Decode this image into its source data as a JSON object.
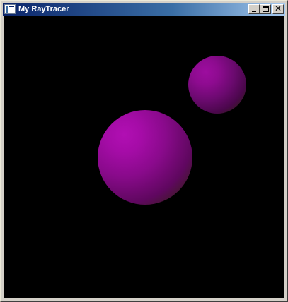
{
  "window": {
    "title": "My RayTracer"
  },
  "titlebar": {
    "buttons": [
      {
        "name": "minimize",
        "icon": "minimize-icon"
      },
      {
        "name": "maximize",
        "icon": "maximize-icon"
      },
      {
        "name": "close",
        "icon": "close-icon",
        "glyph": "✕"
      }
    ]
  },
  "scene": {
    "background": "#000000",
    "spheres": [
      {
        "name": "large-sphere",
        "color": "#a50ca7",
        "shadow_color": "#5c5a08"
      },
      {
        "name": "small-sphere",
        "color": "#8e0b90",
        "shadow_color": "#5a5908"
      }
    ]
  },
  "colors": {
    "titlebar_start": "#0a246a",
    "titlebar_end": "#a6caf0",
    "frame": "#d4d0c8"
  }
}
